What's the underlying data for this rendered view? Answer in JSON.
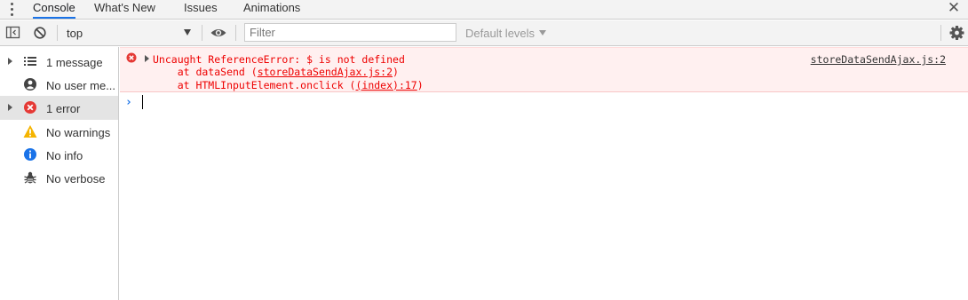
{
  "tabs": [
    "Console",
    "What's New",
    "Issues",
    "Animations"
  ],
  "toolbar": {
    "context": "top",
    "filter_placeholder": "Filter",
    "levels": "Default levels"
  },
  "sidebar": {
    "items": [
      {
        "label": "1 message",
        "icon": "list-icon"
      },
      {
        "label": "No user me...",
        "icon": "user-icon"
      },
      {
        "label": "1 error",
        "icon": "error-icon"
      },
      {
        "label": "No warnings",
        "icon": "warning-icon"
      },
      {
        "label": "No info",
        "icon": "info-icon"
      },
      {
        "label": "No verbose",
        "icon": "bug-icon"
      }
    ]
  },
  "console": {
    "error": {
      "message": "Uncaught ReferenceError: $ is not defined",
      "trace1_prefix": "    at dataSend (",
      "trace1_link": "storeDataSendAjax.js:2",
      "trace1_suffix": ")",
      "trace2_prefix": "    at HTMLInputElement.onclick (",
      "trace2_link": "(index):17",
      "trace2_suffix": ")",
      "source": "storeDataSendAjax.js:2"
    }
  },
  "colors": {
    "accent": "#1a73e8",
    "error_text": "#ee0000",
    "error_bg": "#fff0f0",
    "warning": "#f5b400",
    "info": "#1a73e8"
  }
}
